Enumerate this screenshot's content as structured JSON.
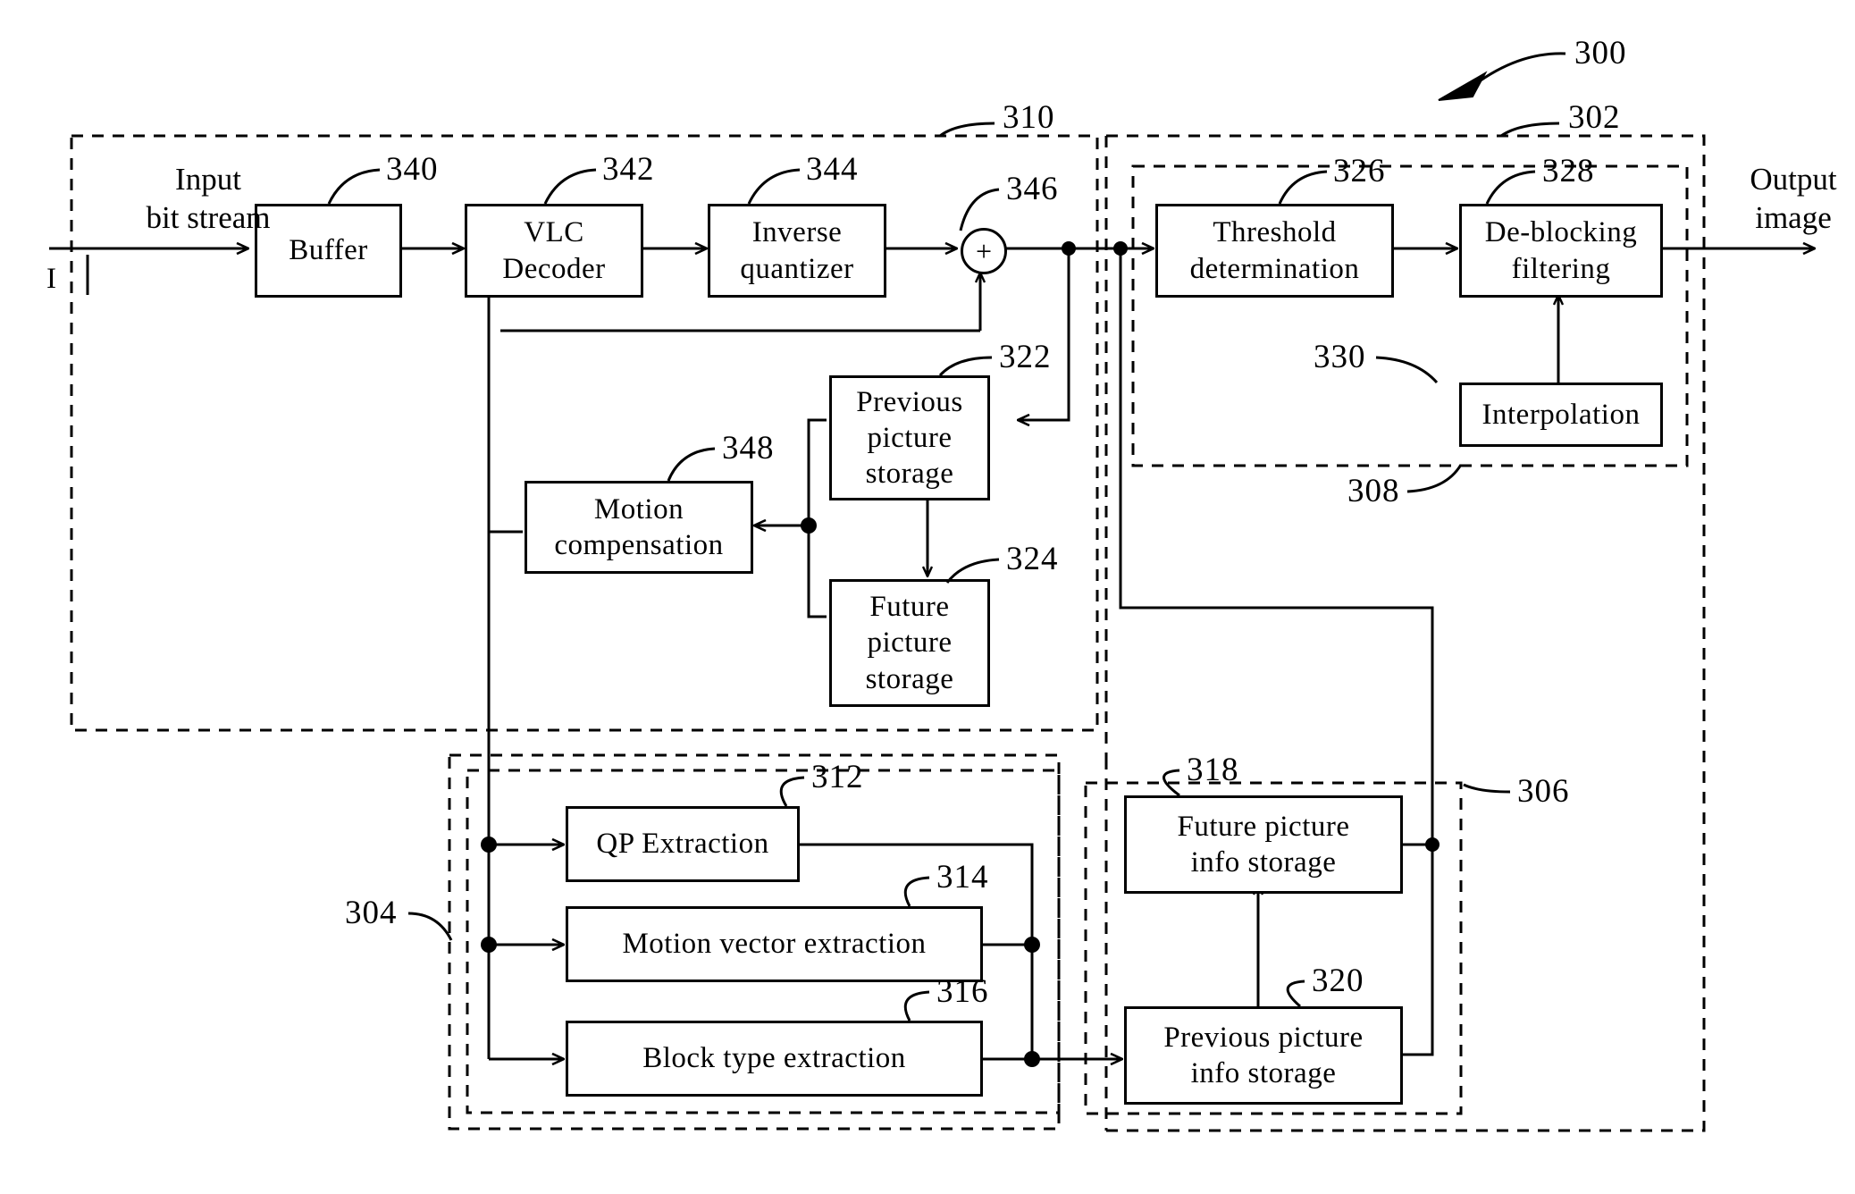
{
  "figure": {
    "title_ref": "300",
    "io_labels": {
      "input": "Input\nbit stream",
      "input_line_marker": "I",
      "output": "Output\nimage"
    }
  },
  "blocks": [
    {
      "id": "buffer",
      "label": "Buffer",
      "ref": "340"
    },
    {
      "id": "vlc",
      "label": "VLC\nDecoder",
      "ref": "342"
    },
    {
      "id": "invq",
      "label": "Inverse\nquantizer",
      "ref": "344"
    },
    {
      "id": "adder",
      "label": "+",
      "ref": "346"
    },
    {
      "id": "prevpic",
      "label": "Previous\npicture\nstorage",
      "ref": "322"
    },
    {
      "id": "futpic",
      "label": "Future\npicture\nstorage",
      "ref": "324"
    },
    {
      "id": "motioncomp",
      "label": "Motion\ncompensation",
      "ref": "348"
    },
    {
      "id": "threshold",
      "label": "Threshold\ndetermination",
      "ref": "326"
    },
    {
      "id": "deblock",
      "label": "De-blocking\nfiltering",
      "ref": "328"
    },
    {
      "id": "interp",
      "label": "Interpolation",
      "ref": "330"
    },
    {
      "id": "qpextract",
      "label": "QP Extraction",
      "ref": "312"
    },
    {
      "id": "mvextract",
      "label": "Motion vector extraction",
      "ref": "314"
    },
    {
      "id": "btextract",
      "label": "Block type extraction",
      "ref": "316"
    },
    {
      "id": "futinfo",
      "label": "Future picture\ninfo storage",
      "ref": "318"
    },
    {
      "id": "previnfo",
      "label": "Previous picture\ninfo storage",
      "ref": "320"
    }
  ],
  "groups": [
    {
      "id": "decoder-group",
      "ref": "310"
    },
    {
      "id": "postproc-group",
      "ref": "302"
    },
    {
      "id": "filter-group",
      "ref": "308"
    },
    {
      "id": "extraction-group",
      "ref": "304"
    },
    {
      "id": "info-group",
      "ref": "306"
    }
  ],
  "refs": {
    "r300": "300",
    "r302": "302",
    "r304": "304",
    "r306": "306",
    "r308": "308",
    "r310": "310",
    "r312": "312",
    "r314": "314",
    "r316": "316",
    "r318": "318",
    "r320": "320",
    "r322": "322",
    "r324": "324",
    "r326": "326",
    "r328": "328",
    "r330": "330",
    "r340": "340",
    "r342": "342",
    "r344": "344",
    "r346": "346",
    "r348": "348"
  },
  "text": {
    "input_line1": "Input",
    "input_line2": "bit stream",
    "input_marker": "I",
    "output_line1": "Output",
    "output_line2": "image",
    "buffer": "Buffer",
    "vlc_line1": "VLC",
    "vlc_line2": "Decoder",
    "invq_line1": "Inverse",
    "invq_line2": "quantizer",
    "adder_sign": "+",
    "prevpic_line1": "Previous",
    "prevpic_line2": "picture",
    "prevpic_line3": "storage",
    "futpic_line1": "Future",
    "futpic_line2": "picture",
    "futpic_line3": "storage",
    "mc_line1": "Motion",
    "mc_line2": "compensation",
    "thr_line1": "Threshold",
    "thr_line2": "determination",
    "dbf_line1": "De-blocking",
    "dbf_line2": "filtering",
    "interp": "Interpolation",
    "qp": "QP Extraction",
    "mv": "Motion vector extraction",
    "bt": "Block type extraction",
    "futinfo_line1": "Future picture",
    "futinfo_line2": "info storage",
    "previnfo_line1": "Previous picture",
    "previnfo_line2": "info storage"
  },
  "colors": {
    "stroke": "#000000",
    "background": "#ffffff"
  }
}
